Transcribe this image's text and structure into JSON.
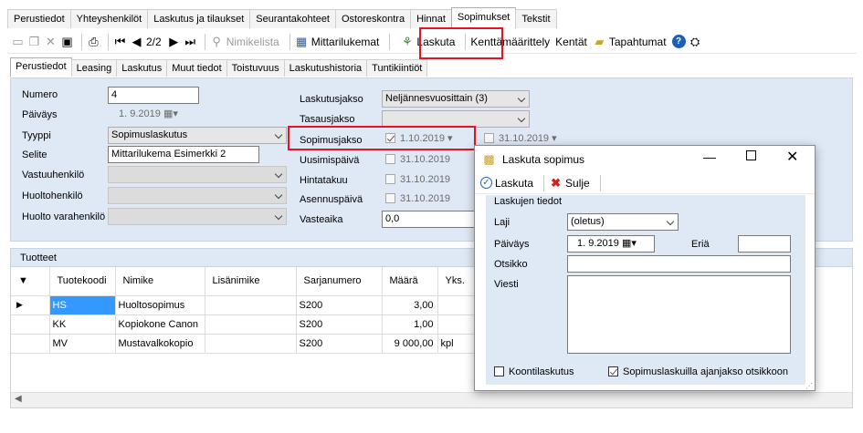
{
  "top_tabs": [
    "Perustiedot",
    "Yhteyshenkilöt",
    "Laskutus ja tilaukset",
    "Seurantakohteet",
    "Ostoreskontra",
    "Hinnat",
    "Sopimukset",
    "Tekstit"
  ],
  "toolbar": {
    "record_pos": "2/2",
    "nimikelista": "Nimikelista",
    "mittarilukema": "Mittarilukemat",
    "laskuta": "Laskuta",
    "kenttamaarittely": "Kenttämäärittely",
    "kentat": "Kentät",
    "tapahtumat": "Tapahtumat"
  },
  "inner_tabs": [
    "Perustiedot",
    "Leasing",
    "Laskutus",
    "Muut tiedot",
    "Toistuvuus",
    "Laskutushistoria",
    "Tuntikiintiöt"
  ],
  "form": {
    "numero_label": "Numero",
    "numero": "4",
    "paivays_label": "Päiväys",
    "paivays": "1. 9.2019",
    "tyyppi_label": "Tyyppi",
    "tyyppi": "Sopimuslaskutus",
    "selite_label": "Selite",
    "selite": "Mittarilukema Esimerkki 2",
    "vastuuhenkilo_label": "Vastuuhenkilö",
    "huoltohenkilo_label": "Huoltohenkilö",
    "huolto_vara_label": "Huolto varahenkilö",
    "laskutusjakso_label": "Laskutusjakso",
    "laskutusjakso": "Neljännesvuosittain (3)",
    "tasausjakso_label": "Tasausjakso",
    "sopimusjakso_label": "Sopimusjakso",
    "sopimusjakso_alku": "1.10.2019",
    "sopimusjakso_loppu": "31.10.2019",
    "uusimispaiva_label": "Uusimispäivä",
    "uusimispaiva": "31.10.2019",
    "hintatakuu_label": "Hintatakuu",
    "hintatakuu": "31.10.2019",
    "asennuspaiva_label": "Asennuspäivä",
    "asennuspaiva": "31.10.2019",
    "vasteaika_label": "Vasteaika",
    "vasteaika": "0,0"
  },
  "grid": {
    "title": "Tuotteet",
    "columns": [
      "Tuotekoodi",
      "Nimike",
      "Lisänimike",
      "Sarjanumero",
      "Määrä",
      "Yks."
    ],
    "rows": [
      {
        "code": "HS",
        "name": "Huoltosopimus",
        "extra": "",
        "serial": "S200",
        "qty": "3,00",
        "unit": ""
      },
      {
        "code": "KK",
        "name": "Kopiokone Canon",
        "extra": "",
        "serial": "S200",
        "qty": "1,00",
        "unit": ""
      },
      {
        "code": "MV",
        "name": "Mustavalkokopio",
        "extra": "",
        "serial": "S200",
        "qty": "9 000,00",
        "unit": "kpl"
      }
    ]
  },
  "dialog": {
    "title": "Laskuta sopimus",
    "laskuta": "Laskuta",
    "sulje": "Sulje",
    "group": "Laskujen tiedot",
    "laji_label": "Laji",
    "laji": "(oletus)",
    "paivays_label": "Päiväys",
    "paivays": "1. 9.2019",
    "eria_label": "Eriä",
    "otsikko_label": "Otsikko",
    "viesti_label": "Viesti",
    "koontilaskutus": "Koontilaskutus",
    "ajanjakso": "Sopimuslaskuilla ajanjakso otsikkoon"
  },
  "colors": {
    "highlight": "#e81123",
    "selection": "#3399ff",
    "panel": "#dfe8f5"
  }
}
